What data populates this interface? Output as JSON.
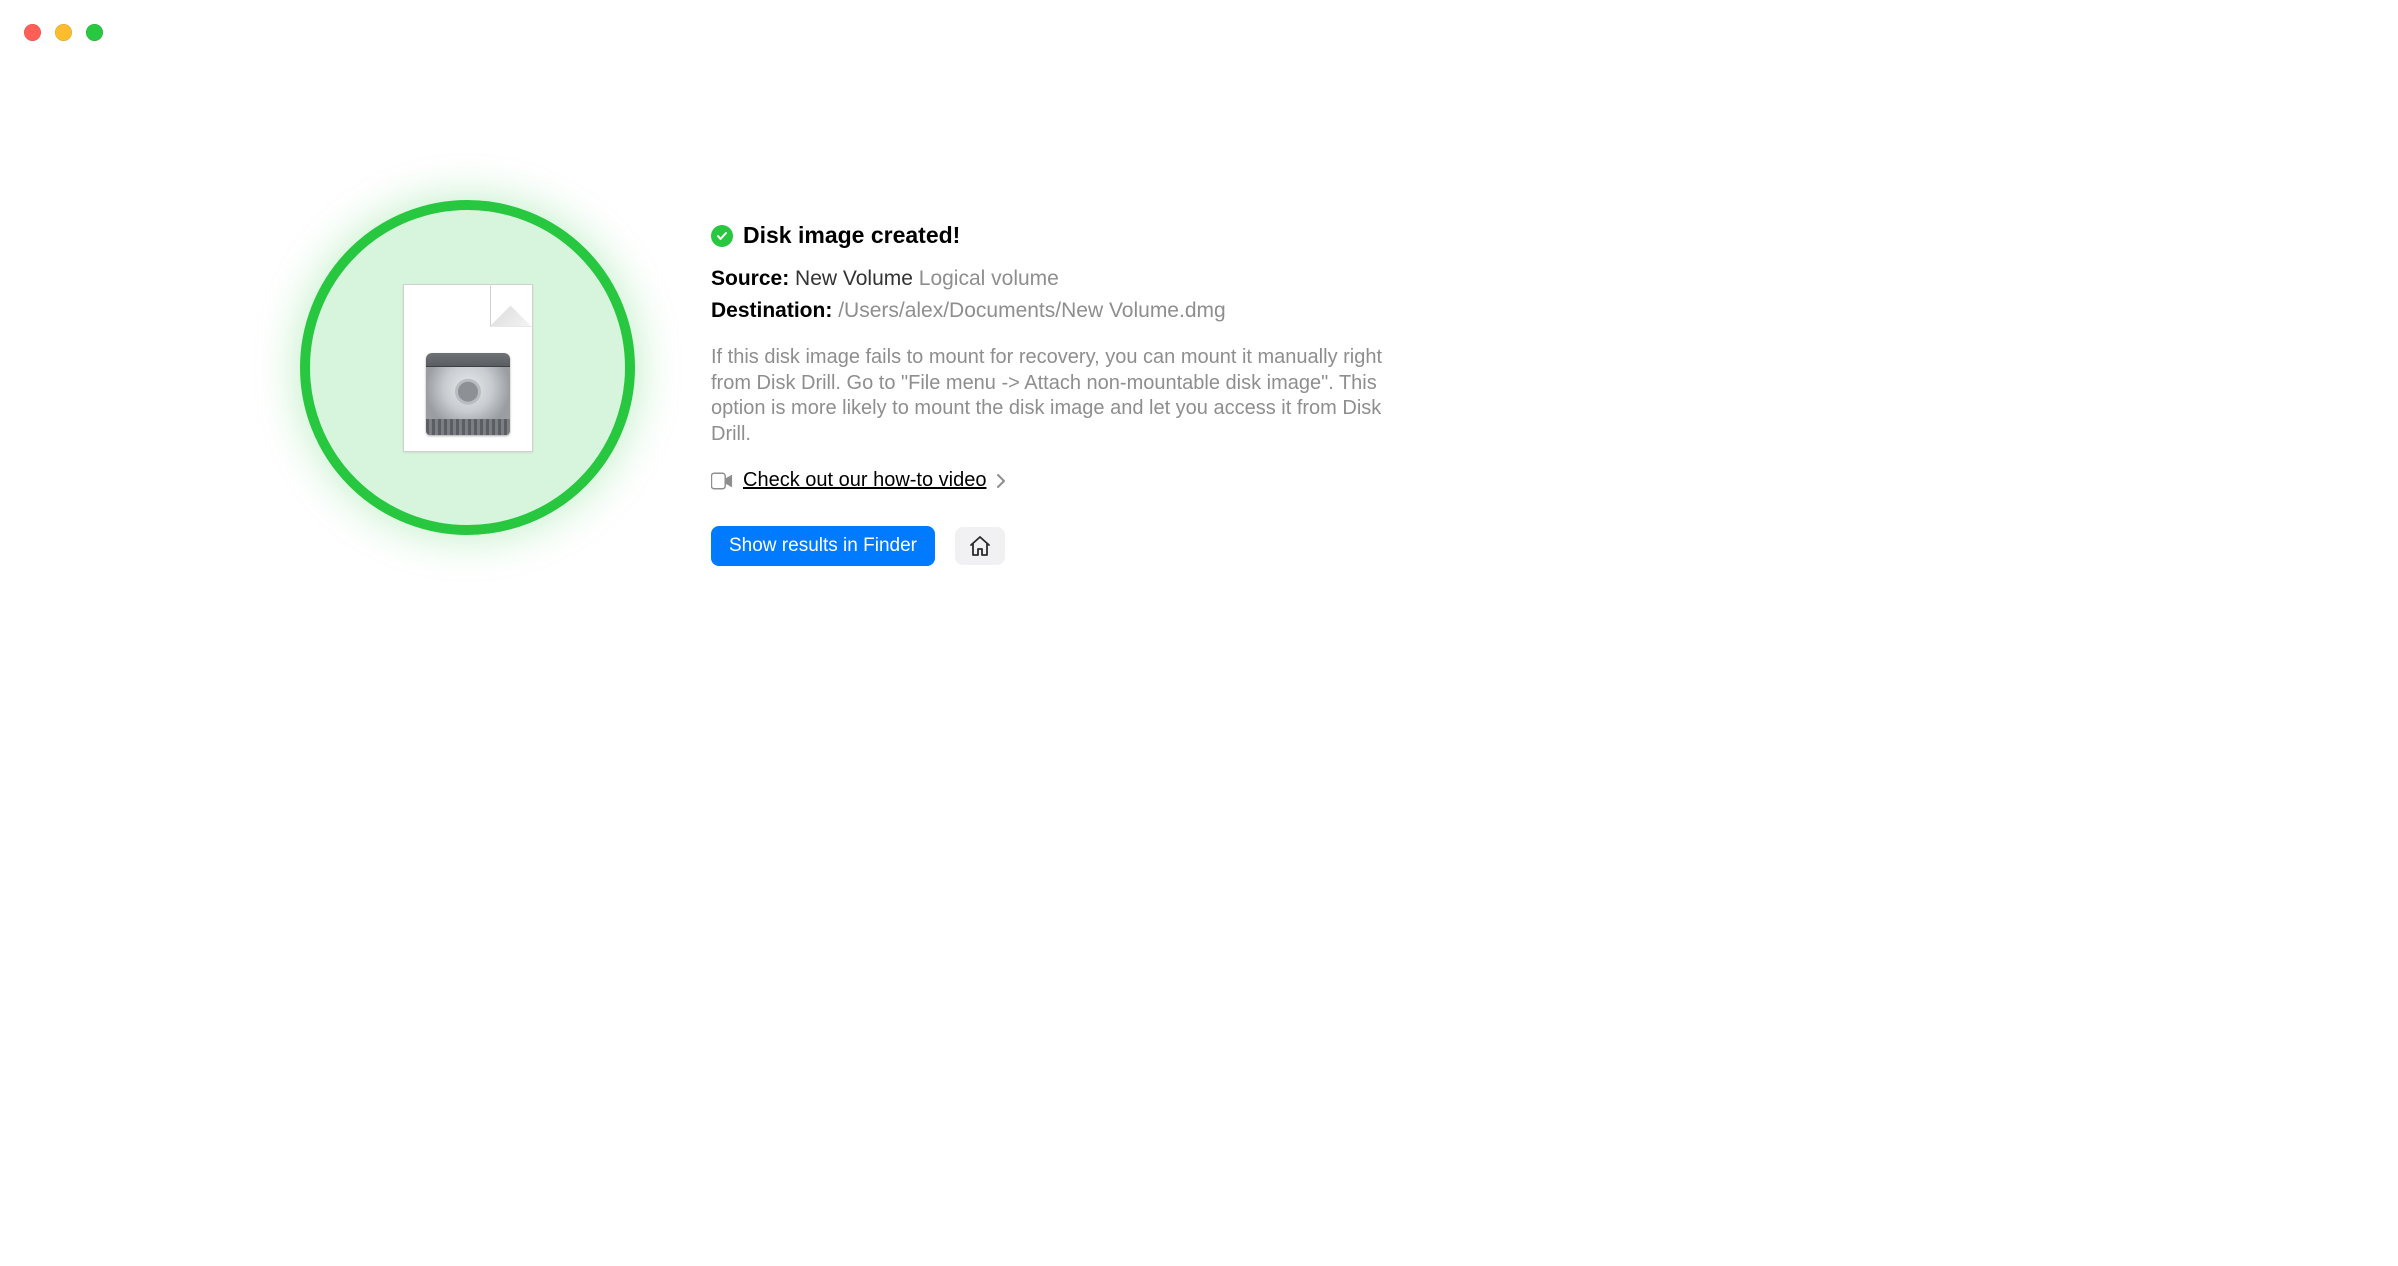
{
  "status": {
    "title": "Disk image created!"
  },
  "source": {
    "label": "Source:",
    "value": "New Volume",
    "subtype": "Logical volume"
  },
  "destination": {
    "label": "Destination:",
    "value": "/Users/alex/Documents/New Volume.dmg"
  },
  "help": {
    "text": "If this disk image fails to mount for recovery, you can mount it manually right from Disk Drill. Go to \"File menu -> Attach non-mountable disk image\". This option is more likely to mount the disk image and let you access it from Disk Drill."
  },
  "video": {
    "link_text": "Check out our how-to video"
  },
  "buttons": {
    "show_in_finder": "Show results in Finder"
  }
}
